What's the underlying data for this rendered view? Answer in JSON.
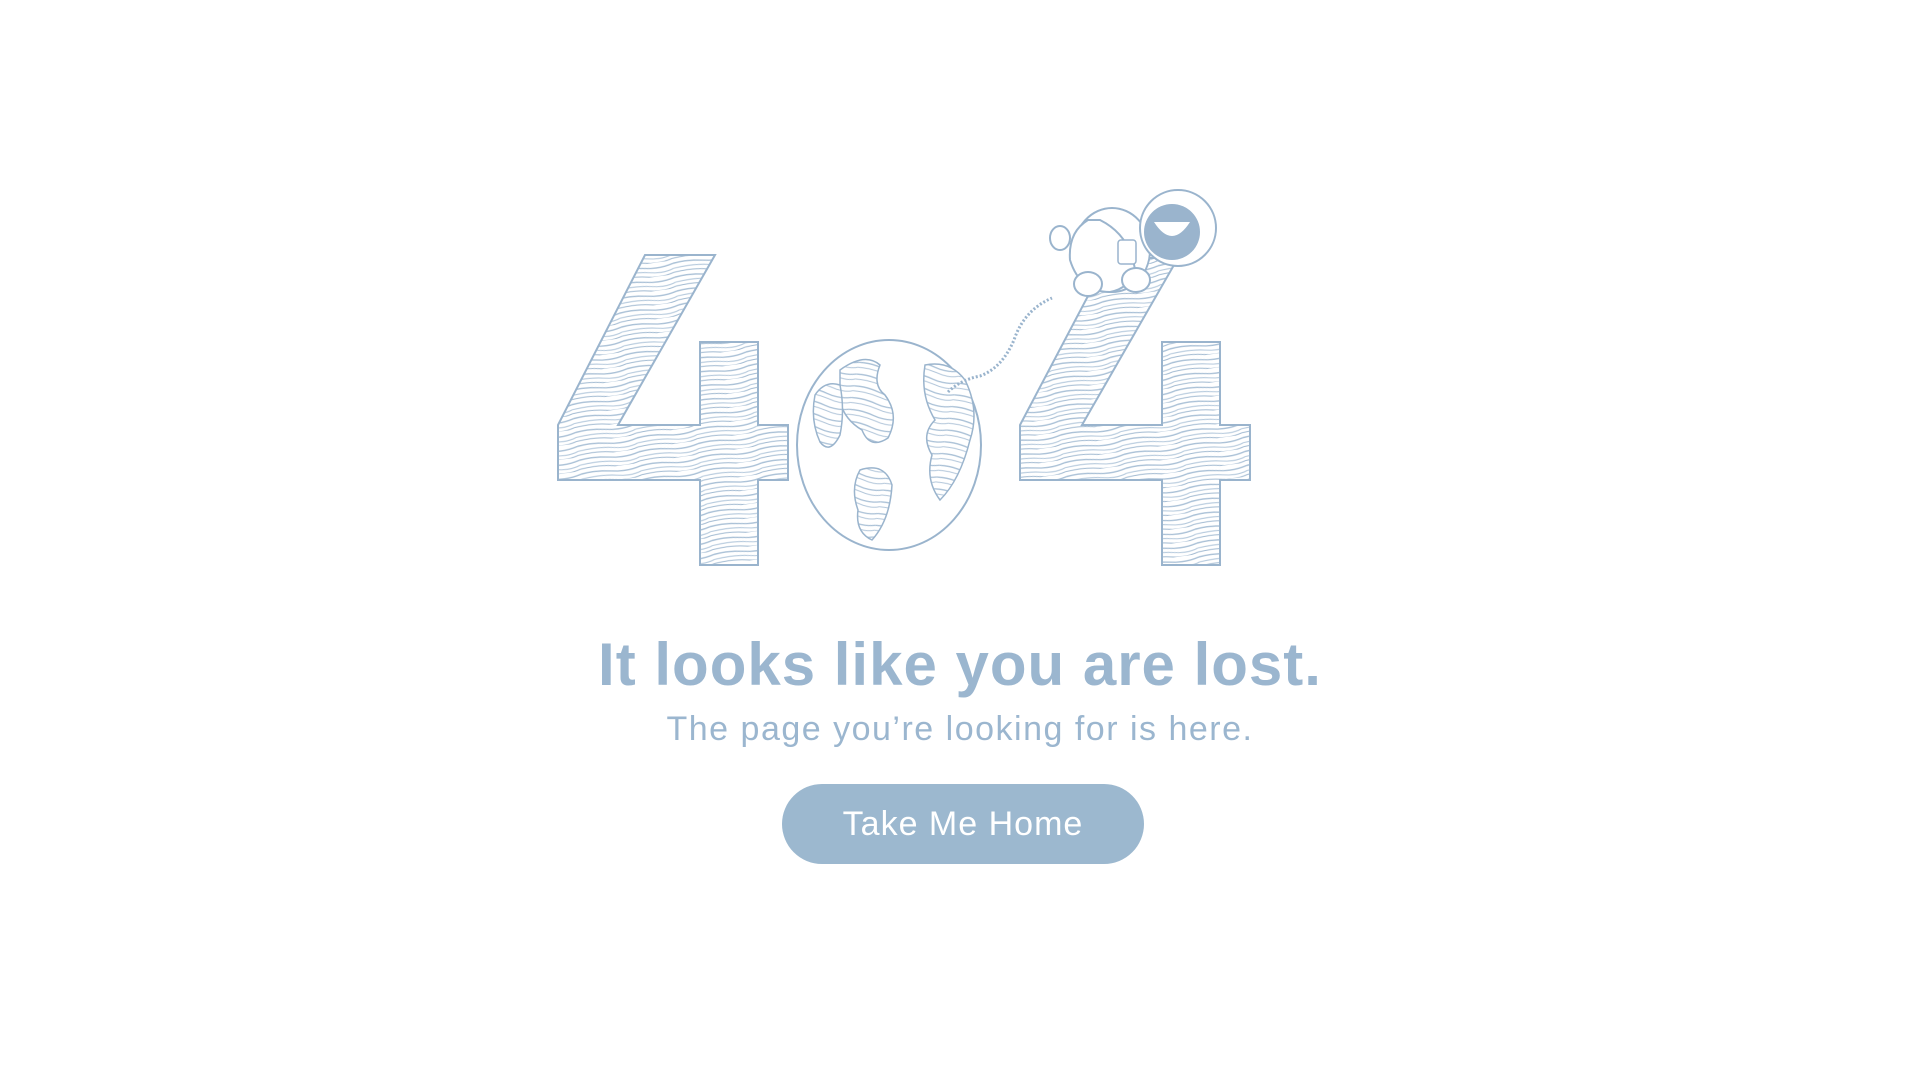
{
  "illustration": {
    "digits": [
      "4",
      "0",
      "4"
    ],
    "zero_icon": "earth-globe-icon",
    "mascot_icon": "astronaut-icon",
    "accent_color": "#9bb6cf"
  },
  "message": {
    "headline": "It looks like you are lost.",
    "subtext": "The page you’re looking for is here."
  },
  "actions": {
    "home_button_label": "Take Me Home",
    "button_color": "#9cb8cf",
    "button_text_color": "#ffffff"
  }
}
